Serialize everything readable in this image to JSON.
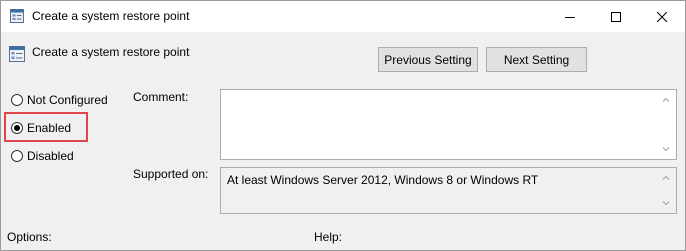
{
  "window": {
    "title": "Create a system restore point"
  },
  "header": {
    "title": "Create a system restore point",
    "prev_button": "Previous Setting",
    "next_button": "Next Setting"
  },
  "options": {
    "items": [
      {
        "label": "Not Configured",
        "checked": false
      },
      {
        "label": "Enabled",
        "checked": true
      },
      {
        "label": "Disabled",
        "checked": false
      }
    ]
  },
  "comment": {
    "label": "Comment:",
    "value": ""
  },
  "supported": {
    "label": "Supported on:",
    "value": "At least Windows Server 2012, Windows 8 or Windows RT"
  },
  "bottom": {
    "options_label": "Options:",
    "help_label": "Help:"
  },
  "colors": {
    "highlight": "#e4434b",
    "window_bg": "#f0f0f0"
  }
}
